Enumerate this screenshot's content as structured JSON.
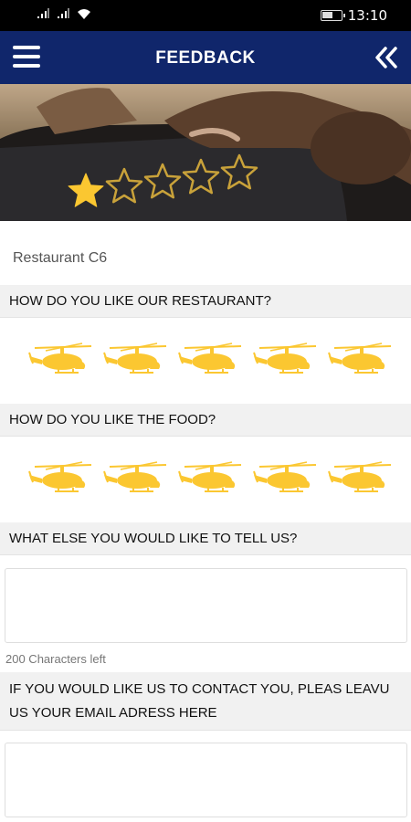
{
  "status_bar": {
    "time": "13:10",
    "battery_level": 0.6
  },
  "app_bar": {
    "title": "FEEDBACK",
    "menu_icon": "hamburger-menu-icon",
    "back_icon": "double-chevron-left-icon"
  },
  "hero": {
    "rating_stars_filled": 1,
    "rating_stars_total": 5
  },
  "restaurant": {
    "name": "Restaurant C6"
  },
  "questions": {
    "restaurant": {
      "label": "HOW DO YOU LIKE OUR RESTAURANT?",
      "icons": 5
    },
    "food": {
      "label": "HOW DO YOU LIKE THE FOOD?",
      "icons": 5
    },
    "comments": {
      "label": "WHAT ELSE YOU WOULD LIKE TO TELL US?",
      "value": "",
      "chars_left": "200 Characters left"
    },
    "email": {
      "label_line1": "IF YOU WOULD LIKE US TO CONTACT YOU, PLEAS LEAVU",
      "label_line2": "US YOUR EMAIL ADRESS HERE",
      "value": ""
    }
  },
  "colors": {
    "app_bar": "#10266b",
    "rating_icon": "#fbc731",
    "section_bg": "#f1f1f1"
  }
}
